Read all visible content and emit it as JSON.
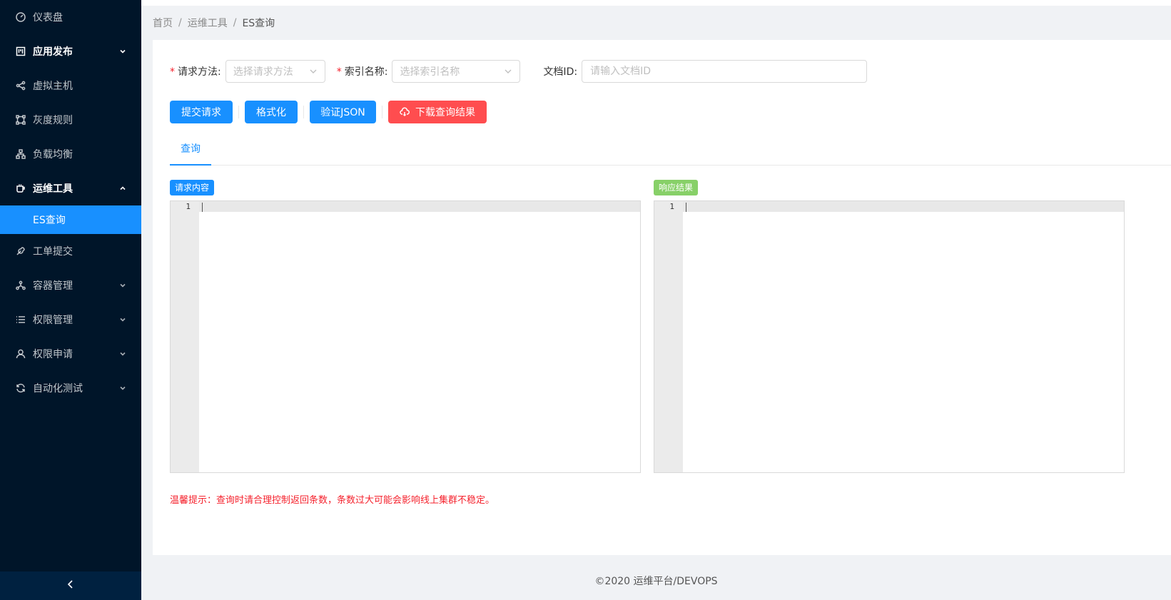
{
  "sidebar": {
    "items": [
      {
        "label": "仪表盘",
        "icon": "dashboard-icon"
      },
      {
        "label": "应用发布",
        "icon": "project-icon"
      },
      {
        "label": "虚拟主机",
        "icon": "share-icon"
      },
      {
        "label": "灰度规则",
        "icon": "gateway-icon"
      },
      {
        "label": "负载均衡",
        "icon": "cluster-icon"
      },
      {
        "label": "运维工具",
        "icon": "tool-cup-icon"
      },
      {
        "label": "ES查询"
      },
      {
        "label": "工单提交",
        "icon": "tool-icon"
      },
      {
        "label": "容器管理",
        "icon": "deployment-icon"
      },
      {
        "label": "权限管理",
        "icon": "list-icon"
      },
      {
        "label": "权限申请",
        "icon": "user-icon"
      },
      {
        "label": "自动化测试",
        "icon": "sync-icon"
      }
    ],
    "collapse_icon": "left-arrow-icon"
  },
  "breadcrumb": [
    "首页",
    "运维工具",
    "ES查询"
  ],
  "form": {
    "method_label": "请求方法:",
    "method_placeholder": "选择请求方法",
    "index_label": "索引名称:",
    "index_placeholder": "选择索引名称",
    "doc_label": "文档ID:",
    "doc_placeholder": "请输入文档ID"
  },
  "buttons": {
    "submit": "提交请求",
    "format": "格式化",
    "validate": "验证JSON",
    "download": "下载查询结果"
  },
  "tabs": [
    "查询"
  ],
  "editors": {
    "request_tag": "请求内容",
    "response_tag": "响应结果",
    "line_number": "1"
  },
  "hint": "温馨提示：查询时请合理控制返回条数，条数过大可能会影响线上集群不稳定。",
  "footer": "©2020 运维平台/DEVOPS",
  "colors": {
    "primary": "#1890ff",
    "danger": "#ff4d4f",
    "success": "#87d068",
    "sidebar": "#001529"
  }
}
